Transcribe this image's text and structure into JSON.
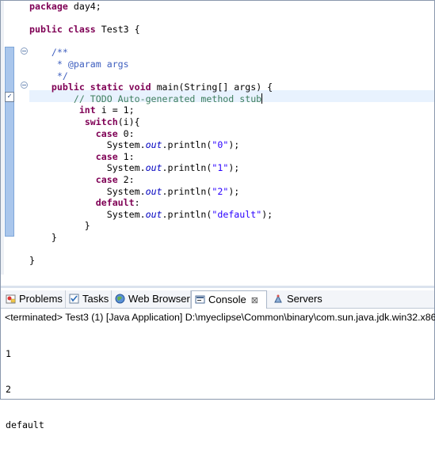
{
  "editor": {
    "lines": [
      [
        {
          "t": "package",
          "c": "kw"
        },
        {
          "t": " day4;"
        }
      ],
      [],
      [
        {
          "t": "public",
          "c": "kw"
        },
        {
          "t": " "
        },
        {
          "t": "class",
          "c": "kw"
        },
        {
          "t": " Test3 {"
        }
      ],
      [],
      [
        {
          "t": "    /**",
          "c": "cm"
        }
      ],
      [
        {
          "t": "     * @param args",
          "c": "cm"
        }
      ],
      [
        {
          "t": "     */",
          "c": "cm"
        }
      ],
      [
        {
          "t": "    "
        },
        {
          "t": "public",
          "c": "kw"
        },
        {
          "t": " "
        },
        {
          "t": "static",
          "c": "kw"
        },
        {
          "t": " "
        },
        {
          "t": "void",
          "c": "kw"
        },
        {
          "t": " main(String[] args) {"
        }
      ],
      [
        {
          "t": "        // TODO Auto-generated method stub",
          "c": "lc"
        }
      ],
      [
        {
          "t": "         "
        },
        {
          "t": "int",
          "c": "kw"
        },
        {
          "t": " i = 1;"
        }
      ],
      [
        {
          "t": "          "
        },
        {
          "t": "switch",
          "c": "kw"
        },
        {
          "t": "(i){"
        }
      ],
      [
        {
          "t": "            "
        },
        {
          "t": "case",
          "c": "kw"
        },
        {
          "t": " 0:"
        }
      ],
      [
        {
          "t": "              System."
        },
        {
          "t": "out",
          "c": "it"
        },
        {
          "t": ".println("
        },
        {
          "t": "\"0\"",
          "c": "st"
        },
        {
          "t": ");"
        }
      ],
      [
        {
          "t": "            "
        },
        {
          "t": "case",
          "c": "kw"
        },
        {
          "t": " 1:"
        }
      ],
      [
        {
          "t": "              System."
        },
        {
          "t": "out",
          "c": "it"
        },
        {
          "t": ".println("
        },
        {
          "t": "\"1\"",
          "c": "st"
        },
        {
          "t": ");"
        }
      ],
      [
        {
          "t": "            "
        },
        {
          "t": "case",
          "c": "kw"
        },
        {
          "t": " 2:"
        }
      ],
      [
        {
          "t": "              System."
        },
        {
          "t": "out",
          "c": "it"
        },
        {
          "t": ".println("
        },
        {
          "t": "\"2\"",
          "c": "st"
        },
        {
          "t": ");"
        }
      ],
      [
        {
          "t": "            "
        },
        {
          "t": "default",
          "c": "kw"
        },
        {
          "t": ":"
        }
      ],
      [
        {
          "t": "              System."
        },
        {
          "t": "out",
          "c": "it"
        },
        {
          "t": ".println("
        },
        {
          "t": "\"default\"",
          "c": "st"
        },
        {
          "t": ");"
        }
      ],
      [
        {
          "t": "          }"
        }
      ],
      [
        {
          "t": "    }"
        }
      ],
      [],
      [
        {
          "t": "}"
        }
      ]
    ]
  },
  "panel": {
    "tabs": {
      "problems": "Problems",
      "tasks": "Tasks",
      "web_browser": "Web Browser",
      "console": "Console",
      "console_close": "⊠",
      "servers": "Servers"
    },
    "console": {
      "terminated": "<terminated> Test3 (1) [Java Application] D:\\myeclipse\\Common\\binary\\com.sun.java.jdk.win32.x86",
      "output": [
        "1",
        "2",
        "default"
      ]
    }
  },
  "colors": {
    "keyword": "#7f0055",
    "javadoc": "#3f5fbf",
    "line_comment": "#3f7f5f",
    "string": "#2a00ff",
    "static_field": "#0000c0",
    "current_line": "#e8f2fe"
  }
}
